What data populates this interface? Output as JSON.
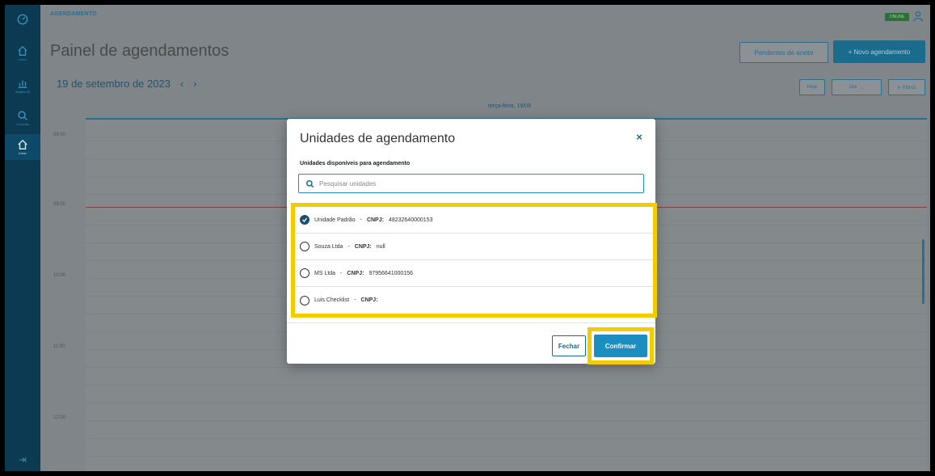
{
  "sidebar": {
    "items": [
      {
        "icon": "gauge-icon",
        "label": ""
      },
      {
        "icon": "home-icon",
        "label": "Início"
      },
      {
        "icon": "chart-icon",
        "label": "Insights BI"
      },
      {
        "icon": "search-icon",
        "label": "Consulta"
      },
      {
        "icon": "home-icon",
        "label": "Início"
      }
    ]
  },
  "header": {
    "breadcrumb": "AGENDAMENTO",
    "online_badge": "ONLINE",
    "title": "Painel de agendamentos",
    "pendentes_label": "Pendentes de aceite",
    "novo_label": "+ Novo agendamento"
  },
  "toolbar": {
    "date": "19 de setembro de 2023",
    "hoje_label": "Hoje",
    "dia_label": "Dia",
    "filtros_label": "⊳ Filtros"
  },
  "calendar": {
    "day_header": "terça-feira, 19/09",
    "hours": [
      "08:00",
      "09:00",
      "10:00",
      "11:00",
      "12:00"
    ]
  },
  "modal": {
    "title": "Unidades de agendamento",
    "close_label": "×",
    "section_label": "Unidades disponíveis para agendamento",
    "search_placeholder": "Pesquisar unidades",
    "units": [
      {
        "name": "Unidade Padrão",
        "cnpj_label": "CNPJ:",
        "cnpj": "48232640000153",
        "checked": true
      },
      {
        "name": "Souza Ltda",
        "cnpj_label": "CNPJ:",
        "cnpj": "null",
        "checked": false
      },
      {
        "name": "MS Ltda",
        "cnpj_label": "CNPJ:",
        "cnpj": "97956641000156",
        "checked": false
      },
      {
        "name": "Luis Checklist",
        "cnpj_label": "CNPJ:",
        "cnpj": "",
        "checked": false
      }
    ],
    "fechar_label": "Fechar",
    "confirmar_label": "Confirmar"
  },
  "colors": {
    "accent": "#1b8dc0",
    "highlight": "#f2cb00",
    "sidebar": "#0b3a52"
  }
}
